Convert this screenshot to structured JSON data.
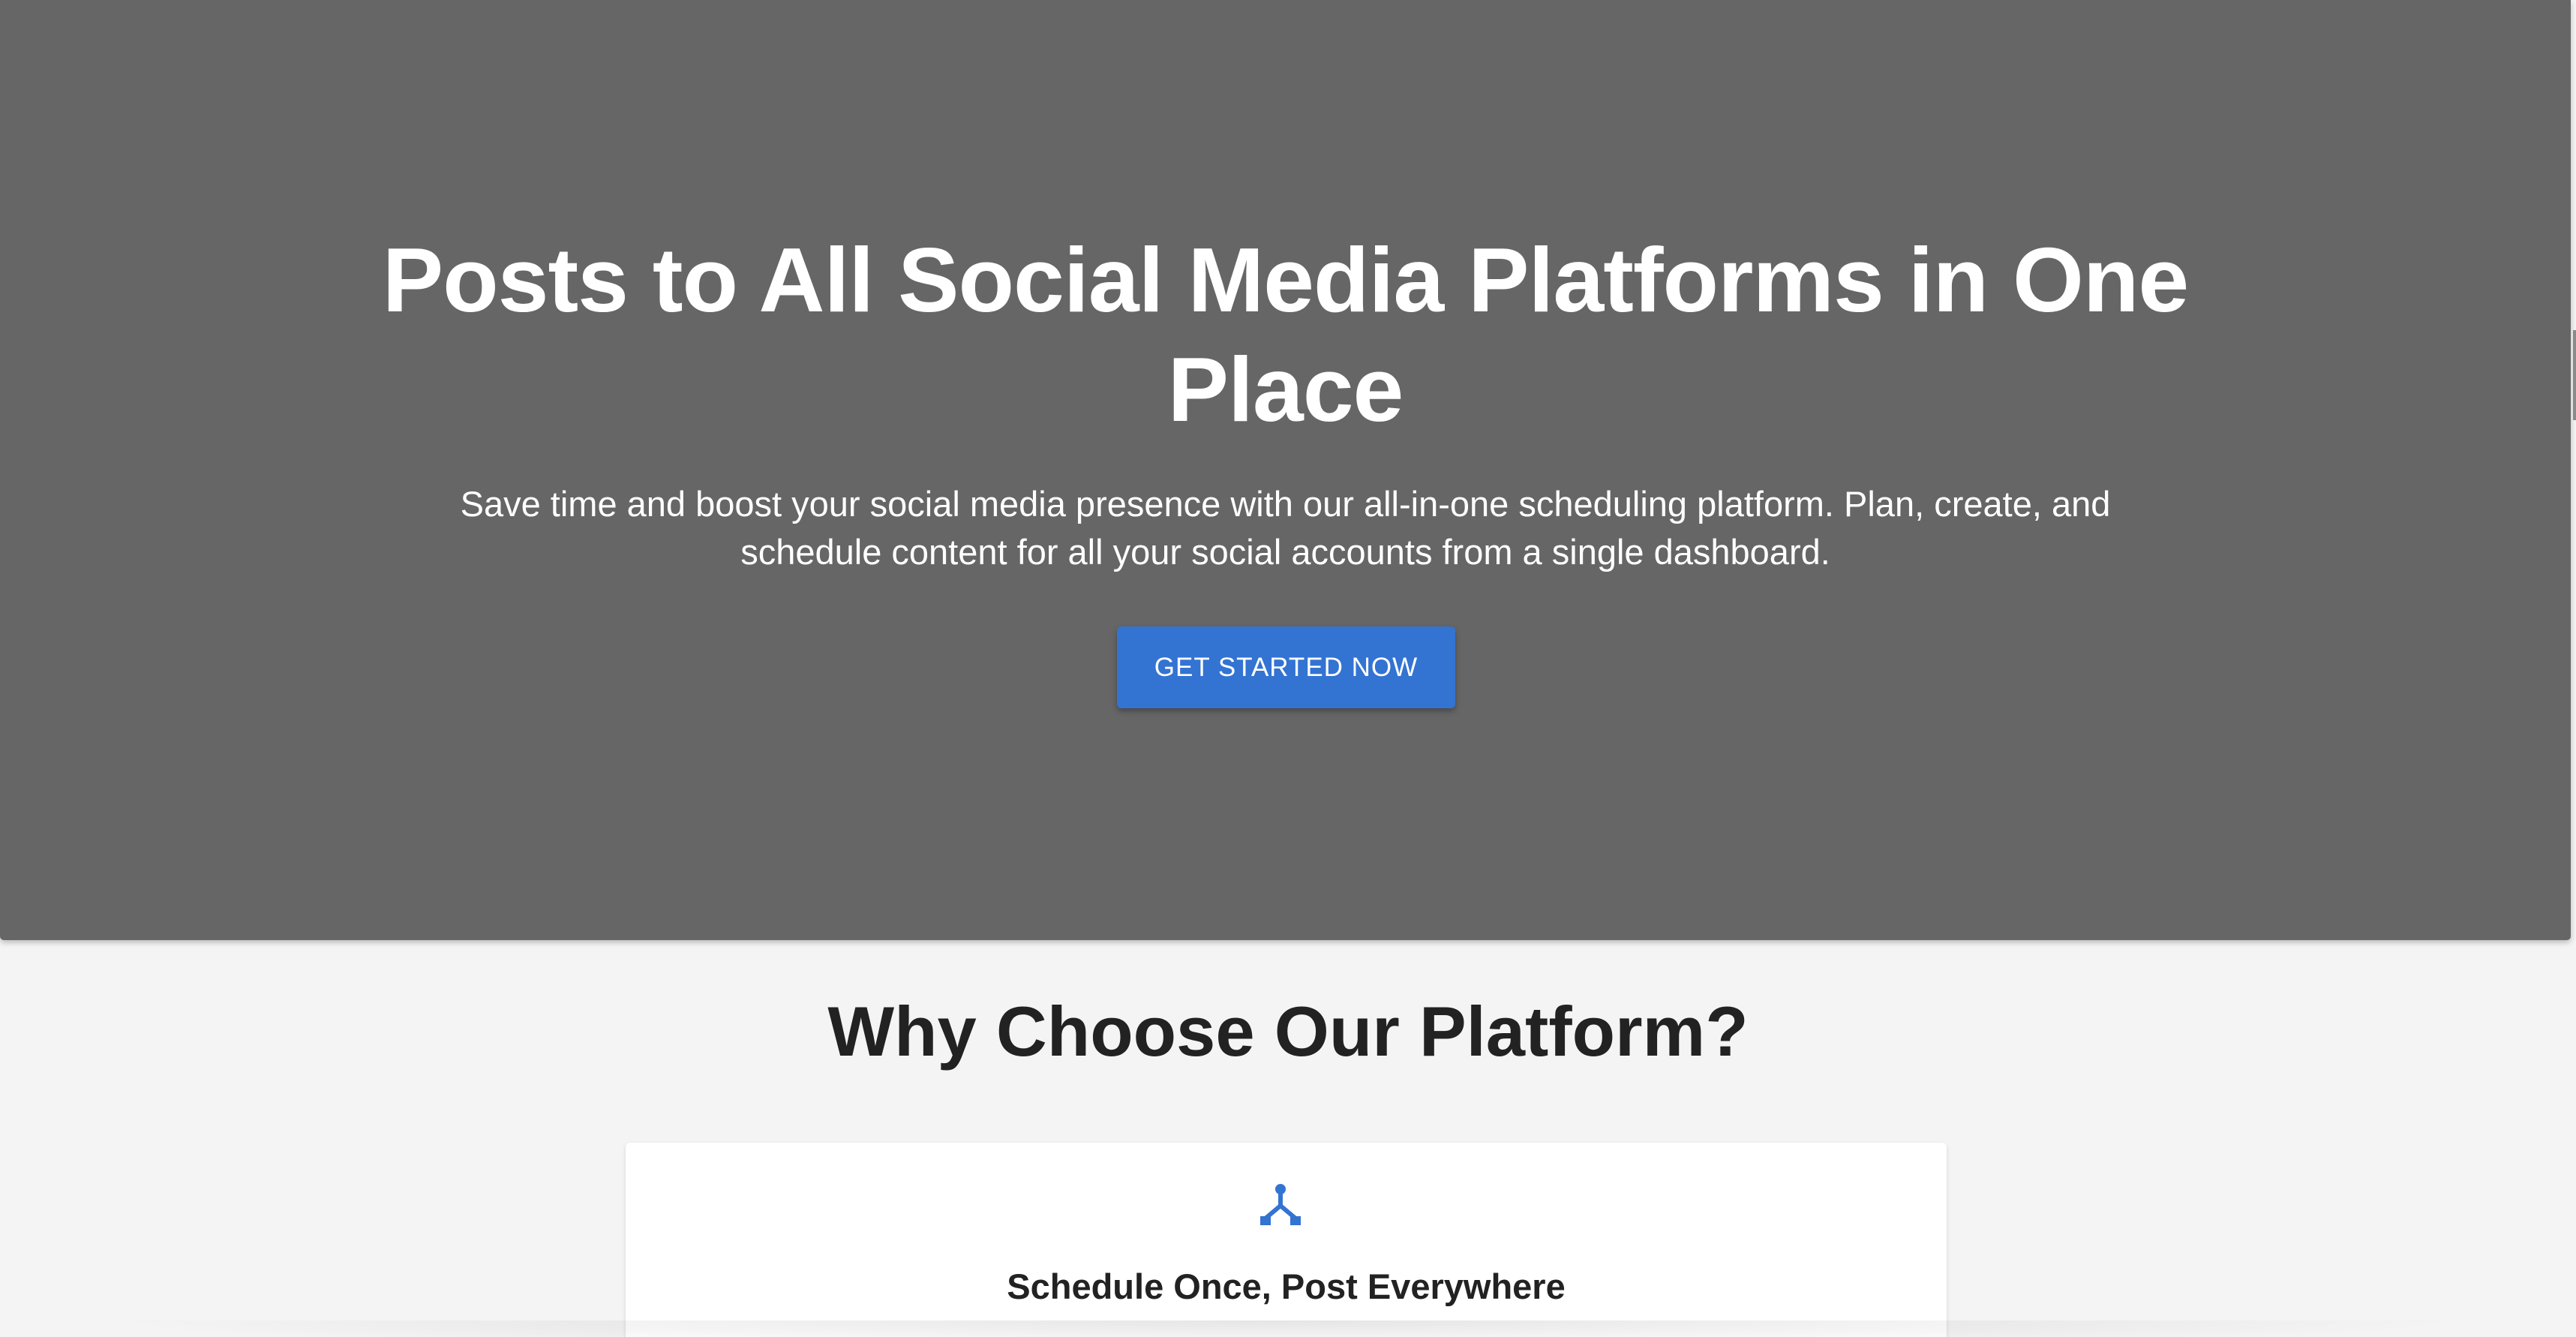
{
  "hero": {
    "title": "Posts to All Social Media Platforms in One Place",
    "subtitle": "Save time and boost your social media presence with our all-in-one scheduling platform. Plan, create, and schedule content for all your social accounts from a single dashboard.",
    "cta_label": "GET STARTED NOW",
    "background_color": "#666666",
    "cta_color": "#3373d2"
  },
  "features": {
    "section_title": "Why Choose Our Platform?",
    "cards": [
      {
        "icon": "merge-icon",
        "title": "Schedule Once, Post Everywhere"
      }
    ]
  }
}
